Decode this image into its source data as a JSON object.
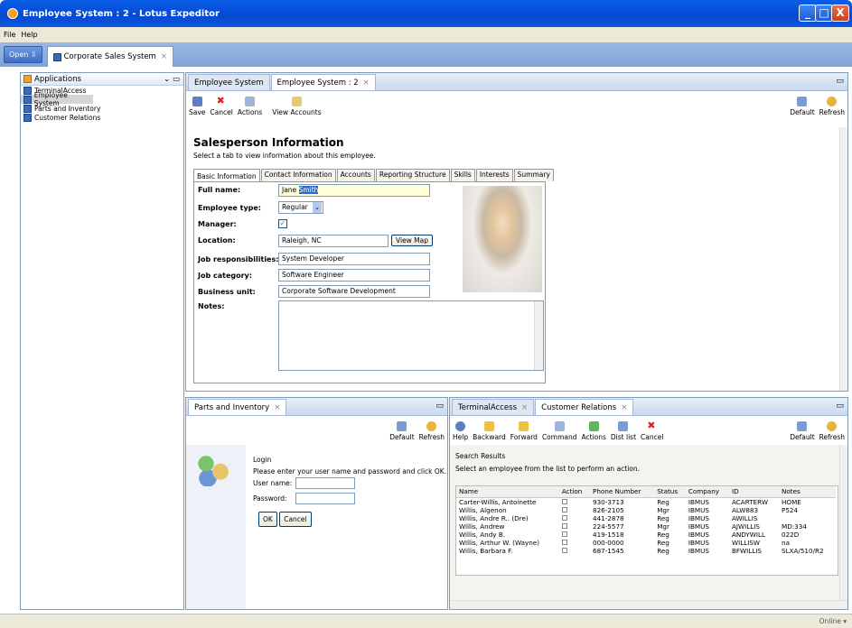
{
  "window": {
    "title": "Employee System : 2 - Lotus Expeditor",
    "min": "_",
    "max": "□",
    "close": "X"
  },
  "menu": {
    "file": "File",
    "help": "Help"
  },
  "launcher": {
    "open": "Open ⇩",
    "app_tab": "Corporate Sales System"
  },
  "sidebar": {
    "title": "Applications",
    "items": [
      {
        "label": "TerminalAccess"
      },
      {
        "label": "Employee System"
      },
      {
        "label": "Parts and Inventory"
      },
      {
        "label": "Customer Relations"
      }
    ]
  },
  "main": {
    "tabs": [
      {
        "label": "Employee System"
      },
      {
        "label": "Employee System : 2"
      }
    ],
    "toolbar": {
      "save": "Save",
      "cancel": "Cancel",
      "actions": "Actions",
      "view_accounts": "View Accounts",
      "default": "Default",
      "refresh": "Refresh"
    },
    "heading": "Salesperson Information",
    "subheading": "Select a tab to view information about this employee.",
    "subtabs": [
      "Basic Information",
      "Contact Information",
      "Accounts",
      "Reporting Structure",
      "Skills",
      "Interests",
      "Summary"
    ],
    "form": {
      "full_name_label": "Full name:",
      "full_name_first": "Jane ",
      "full_name_last": "Smith",
      "employee_type_label": "Employee type:",
      "employee_type": "Regular",
      "manager_label": "Manager:",
      "location_label": "Location:",
      "location": "Raleigh, NC",
      "view_map": "View Map",
      "job_resp_label": "Job responsibilities:",
      "job_resp": "System Developer",
      "job_cat_label": "Job category:",
      "job_cat": "Software Engineer",
      "bu_label": "Business unit:",
      "bu": "Corporate Software Development",
      "notes_label": "Notes:"
    }
  },
  "parts": {
    "tab": "Parts and Inventory",
    "default": "Default",
    "refresh": "Refresh",
    "login_title": "Login",
    "login_msg": "Please enter your user name and password and click OK.",
    "user_label": "User name:",
    "pass_label": "Password:",
    "ok": "OK",
    "cancel": "Cancel"
  },
  "terminal": {
    "tabs": [
      {
        "label": "TerminalAccess"
      },
      {
        "label": "Customer Relations"
      }
    ],
    "toolbar": [
      "Help",
      "Backward",
      "Forward",
      "Command",
      "Actions",
      "Dist list",
      "Cancel"
    ],
    "default": "Default",
    "refresh": "Refresh",
    "results_title": "Search Results",
    "results_msg": "Select an employee from the list to perform an action.",
    "columns": [
      "Name",
      "Action",
      "Phone Number",
      "Status",
      "Company",
      "ID",
      "Notes"
    ],
    "rows": [
      [
        "Carter-Willis, Antoinette",
        "930-3713",
        "Reg",
        "IBMUS",
        "ACARTERW",
        "HOME"
      ],
      [
        "Willis, Algenon",
        "826-2105",
        "Mgr",
        "IBMUS",
        "ALW883",
        "P524"
      ],
      [
        "Willis, Andre R.. (Dre)",
        "441-2878",
        "Reg",
        "IBMUS",
        "AWILLIS",
        ""
      ],
      [
        "Willis, Andrew",
        "224-5577",
        "Mgr",
        "IBMUS",
        "AJWILLIS",
        "MD:334"
      ],
      [
        "Willis, Andy B.",
        "419-1518",
        "Reg",
        "IBMUS",
        "ANDYWILL",
        "022D"
      ],
      [
        "Willis, Arthur W. (Wayne)",
        "000-0000",
        "Reg",
        "IBMUS",
        "WILLISW",
        "na"
      ],
      [
        "Willis, Barbara F.",
        "687-1545",
        "Reg",
        "IBMUS",
        "BFWILLIS",
        "SLXA/510/R2"
      ]
    ]
  },
  "status": {
    "online": "Online ▾"
  }
}
